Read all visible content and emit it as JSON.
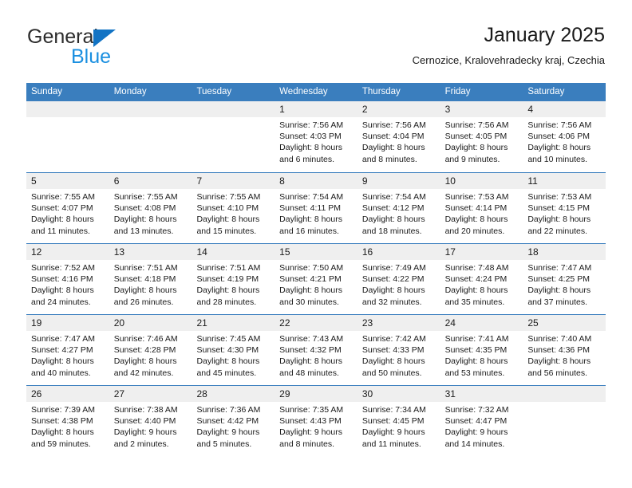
{
  "logo": {
    "word_top": "General",
    "word_bottom": "Blue",
    "triangle_icon": "triangle-icon",
    "color_dark": "#2b2b2b",
    "color_blue": "#1a8fe0"
  },
  "header": {
    "title": "January 2025",
    "subtitle": "Cernozice, Kralovehradecky kraj, Czechia"
  },
  "colors": {
    "header_band": "#3a7ebe",
    "day_number_band": "#efefef",
    "text": "#1a1a1a"
  },
  "weekdays": [
    "Sunday",
    "Monday",
    "Tuesday",
    "Wednesday",
    "Thursday",
    "Friday",
    "Saturday"
  ],
  "weeks": [
    [
      {
        "day": "",
        "sunrise": "",
        "sunset": "",
        "daylight_line1": "",
        "daylight_line2": ""
      },
      {
        "day": "",
        "sunrise": "",
        "sunset": "",
        "daylight_line1": "",
        "daylight_line2": ""
      },
      {
        "day": "",
        "sunrise": "",
        "sunset": "",
        "daylight_line1": "",
        "daylight_line2": ""
      },
      {
        "day": "1",
        "sunrise": "Sunrise: 7:56 AM",
        "sunset": "Sunset: 4:03 PM",
        "daylight_line1": "Daylight: 8 hours",
        "daylight_line2": "and 6 minutes."
      },
      {
        "day": "2",
        "sunrise": "Sunrise: 7:56 AM",
        "sunset": "Sunset: 4:04 PM",
        "daylight_line1": "Daylight: 8 hours",
        "daylight_line2": "and 8 minutes."
      },
      {
        "day": "3",
        "sunrise": "Sunrise: 7:56 AM",
        "sunset": "Sunset: 4:05 PM",
        "daylight_line1": "Daylight: 8 hours",
        "daylight_line2": "and 9 minutes."
      },
      {
        "day": "4",
        "sunrise": "Sunrise: 7:56 AM",
        "sunset": "Sunset: 4:06 PM",
        "daylight_line1": "Daylight: 8 hours",
        "daylight_line2": "and 10 minutes."
      }
    ],
    [
      {
        "day": "5",
        "sunrise": "Sunrise: 7:55 AM",
        "sunset": "Sunset: 4:07 PM",
        "daylight_line1": "Daylight: 8 hours",
        "daylight_line2": "and 11 minutes."
      },
      {
        "day": "6",
        "sunrise": "Sunrise: 7:55 AM",
        "sunset": "Sunset: 4:08 PM",
        "daylight_line1": "Daylight: 8 hours",
        "daylight_line2": "and 13 minutes."
      },
      {
        "day": "7",
        "sunrise": "Sunrise: 7:55 AM",
        "sunset": "Sunset: 4:10 PM",
        "daylight_line1": "Daylight: 8 hours",
        "daylight_line2": "and 15 minutes."
      },
      {
        "day": "8",
        "sunrise": "Sunrise: 7:54 AM",
        "sunset": "Sunset: 4:11 PM",
        "daylight_line1": "Daylight: 8 hours",
        "daylight_line2": "and 16 minutes."
      },
      {
        "day": "9",
        "sunrise": "Sunrise: 7:54 AM",
        "sunset": "Sunset: 4:12 PM",
        "daylight_line1": "Daylight: 8 hours",
        "daylight_line2": "and 18 minutes."
      },
      {
        "day": "10",
        "sunrise": "Sunrise: 7:53 AM",
        "sunset": "Sunset: 4:14 PM",
        "daylight_line1": "Daylight: 8 hours",
        "daylight_line2": "and 20 minutes."
      },
      {
        "day": "11",
        "sunrise": "Sunrise: 7:53 AM",
        "sunset": "Sunset: 4:15 PM",
        "daylight_line1": "Daylight: 8 hours",
        "daylight_line2": "and 22 minutes."
      }
    ],
    [
      {
        "day": "12",
        "sunrise": "Sunrise: 7:52 AM",
        "sunset": "Sunset: 4:16 PM",
        "daylight_line1": "Daylight: 8 hours",
        "daylight_line2": "and 24 minutes."
      },
      {
        "day": "13",
        "sunrise": "Sunrise: 7:51 AM",
        "sunset": "Sunset: 4:18 PM",
        "daylight_line1": "Daylight: 8 hours",
        "daylight_line2": "and 26 minutes."
      },
      {
        "day": "14",
        "sunrise": "Sunrise: 7:51 AM",
        "sunset": "Sunset: 4:19 PM",
        "daylight_line1": "Daylight: 8 hours",
        "daylight_line2": "and 28 minutes."
      },
      {
        "day": "15",
        "sunrise": "Sunrise: 7:50 AM",
        "sunset": "Sunset: 4:21 PM",
        "daylight_line1": "Daylight: 8 hours",
        "daylight_line2": "and 30 minutes."
      },
      {
        "day": "16",
        "sunrise": "Sunrise: 7:49 AM",
        "sunset": "Sunset: 4:22 PM",
        "daylight_line1": "Daylight: 8 hours",
        "daylight_line2": "and 32 minutes."
      },
      {
        "day": "17",
        "sunrise": "Sunrise: 7:48 AM",
        "sunset": "Sunset: 4:24 PM",
        "daylight_line1": "Daylight: 8 hours",
        "daylight_line2": "and 35 minutes."
      },
      {
        "day": "18",
        "sunrise": "Sunrise: 7:47 AM",
        "sunset": "Sunset: 4:25 PM",
        "daylight_line1": "Daylight: 8 hours",
        "daylight_line2": "and 37 minutes."
      }
    ],
    [
      {
        "day": "19",
        "sunrise": "Sunrise: 7:47 AM",
        "sunset": "Sunset: 4:27 PM",
        "daylight_line1": "Daylight: 8 hours",
        "daylight_line2": "and 40 minutes."
      },
      {
        "day": "20",
        "sunrise": "Sunrise: 7:46 AM",
        "sunset": "Sunset: 4:28 PM",
        "daylight_line1": "Daylight: 8 hours",
        "daylight_line2": "and 42 minutes."
      },
      {
        "day": "21",
        "sunrise": "Sunrise: 7:45 AM",
        "sunset": "Sunset: 4:30 PM",
        "daylight_line1": "Daylight: 8 hours",
        "daylight_line2": "and 45 minutes."
      },
      {
        "day": "22",
        "sunrise": "Sunrise: 7:43 AM",
        "sunset": "Sunset: 4:32 PM",
        "daylight_line1": "Daylight: 8 hours",
        "daylight_line2": "and 48 minutes."
      },
      {
        "day": "23",
        "sunrise": "Sunrise: 7:42 AM",
        "sunset": "Sunset: 4:33 PM",
        "daylight_line1": "Daylight: 8 hours",
        "daylight_line2": "and 50 minutes."
      },
      {
        "day": "24",
        "sunrise": "Sunrise: 7:41 AM",
        "sunset": "Sunset: 4:35 PM",
        "daylight_line1": "Daylight: 8 hours",
        "daylight_line2": "and 53 minutes."
      },
      {
        "day": "25",
        "sunrise": "Sunrise: 7:40 AM",
        "sunset": "Sunset: 4:36 PM",
        "daylight_line1": "Daylight: 8 hours",
        "daylight_line2": "and 56 minutes."
      }
    ],
    [
      {
        "day": "26",
        "sunrise": "Sunrise: 7:39 AM",
        "sunset": "Sunset: 4:38 PM",
        "daylight_line1": "Daylight: 8 hours",
        "daylight_line2": "and 59 minutes."
      },
      {
        "day": "27",
        "sunrise": "Sunrise: 7:38 AM",
        "sunset": "Sunset: 4:40 PM",
        "daylight_line1": "Daylight: 9 hours",
        "daylight_line2": "and 2 minutes."
      },
      {
        "day": "28",
        "sunrise": "Sunrise: 7:36 AM",
        "sunset": "Sunset: 4:42 PM",
        "daylight_line1": "Daylight: 9 hours",
        "daylight_line2": "and 5 minutes."
      },
      {
        "day": "29",
        "sunrise": "Sunrise: 7:35 AM",
        "sunset": "Sunset: 4:43 PM",
        "daylight_line1": "Daylight: 9 hours",
        "daylight_line2": "and 8 minutes."
      },
      {
        "day": "30",
        "sunrise": "Sunrise: 7:34 AM",
        "sunset": "Sunset: 4:45 PM",
        "daylight_line1": "Daylight: 9 hours",
        "daylight_line2": "and 11 minutes."
      },
      {
        "day": "31",
        "sunrise": "Sunrise: 7:32 AM",
        "sunset": "Sunset: 4:47 PM",
        "daylight_line1": "Daylight: 9 hours",
        "daylight_line2": "and 14 minutes."
      },
      {
        "day": "",
        "sunrise": "",
        "sunset": "",
        "daylight_line1": "",
        "daylight_line2": ""
      }
    ]
  ]
}
